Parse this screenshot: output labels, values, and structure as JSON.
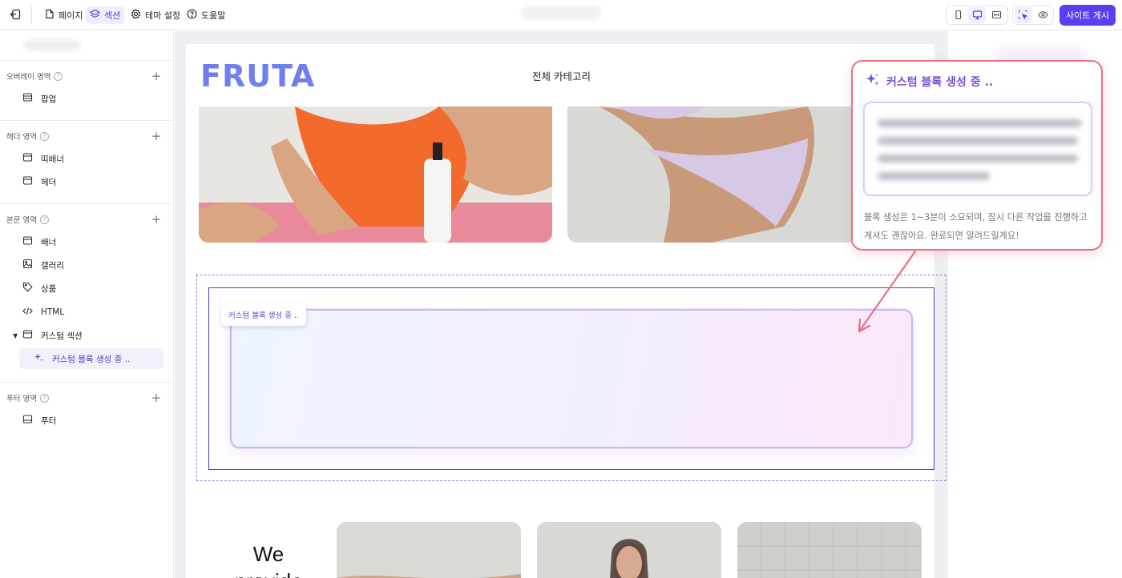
{
  "topbar": {
    "tabs": [
      {
        "label": "페이지",
        "icon": "file-icon"
      },
      {
        "label": "섹션",
        "icon": "layers-icon",
        "active": true
      },
      {
        "label": "테마 설정",
        "icon": "gear-icon"
      },
      {
        "label": "도움말",
        "icon": "help-icon"
      }
    ],
    "devices": [
      "mobile-icon",
      "desktop-icon",
      "fullwidth-icon"
    ],
    "active_device": "desktop",
    "publish_label": "사이트 게시",
    "accent": "#5a3ff0"
  },
  "sidebar": {
    "groups": [
      {
        "title": "오버레이 영역",
        "items": [
          {
            "label": "팝업",
            "icon": "popup-icon"
          }
        ]
      },
      {
        "title": "헤더 영역",
        "items": [
          {
            "label": "띠배너",
            "icon": "banner-strip-icon"
          },
          {
            "label": "헤더",
            "icon": "header-icon"
          }
        ]
      },
      {
        "title": "본문 영역",
        "items": [
          {
            "label": "배너",
            "icon": "banner-icon"
          },
          {
            "label": "갤러리",
            "icon": "image-icon"
          },
          {
            "label": "상품",
            "icon": "tag-icon"
          },
          {
            "label": "HTML",
            "icon": "code-icon"
          },
          {
            "label": "커스텀 섹션",
            "icon": "section-icon",
            "expanded": true
          },
          {
            "label": "커스텀 블록 생성 중 ..",
            "icon": "sparkle-icon",
            "selected": true
          }
        ]
      },
      {
        "title": "푸터 영역",
        "items": [
          {
            "label": "푸터",
            "icon": "footer-icon"
          }
        ]
      }
    ]
  },
  "canvas": {
    "logo": "FRUTA",
    "nav_link": "전체 카테고리",
    "generating_tag": "커스텀 블록 생성 중 ..",
    "headline": "We provide"
  },
  "callout": {
    "title": "커스텀 블록 생성 중 ..",
    "message": "블록 생성은 1~3분이 소요되며, 잠시 다른 작업을 진행하고 계셔도 괜찮아요. 완료되면 알려드릴게요!",
    "border_color": "#ec6f86",
    "title_color": "#7a50d8"
  }
}
